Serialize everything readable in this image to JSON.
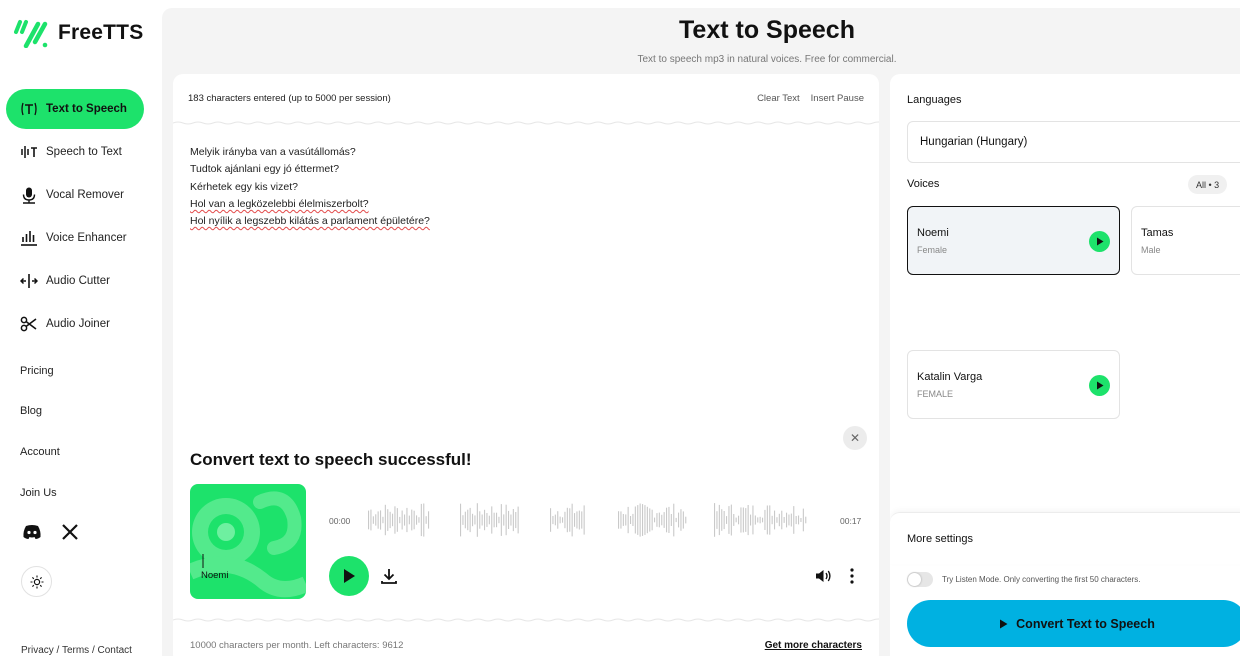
{
  "brand": {
    "name": "FreeTTS",
    "accent": "#1de26b",
    "primary_button": "#00b1e1"
  },
  "sidebar": {
    "items": [
      {
        "label": "Text to Speech",
        "icon": "text-to-speech-icon",
        "active": true
      },
      {
        "label": "Speech to Text",
        "icon": "speech-to-text-icon"
      },
      {
        "label": "Vocal Remover",
        "icon": "microphone-icon"
      },
      {
        "label": "Voice Enhancer",
        "icon": "equalizer-icon"
      },
      {
        "label": "Audio Cutter",
        "icon": "audio-cutter-icon"
      },
      {
        "label": "Audio Joiner",
        "icon": "scissors-icon"
      }
    ],
    "links": [
      "Pricing",
      "Blog",
      "Account",
      "Join Us"
    ],
    "footer": "Privacy / Terms / Contact"
  },
  "header": {
    "title": "Text to Speech",
    "subtitle": "Text to speech mp3 in natural voices. Free for commercial."
  },
  "editor": {
    "char_count": "183 characters entered (up to 5000 per session)",
    "clear_text": "Clear Text",
    "insert_pause": "Insert Pause",
    "lines": [
      "Melyik irányba van a vasútállomás?",
      "Tudtok ajánlani egy jó éttermet?",
      "Kérhetek egy kis vizet?",
      "Hol van a legközelebbi élelmiszerbolt?",
      "Hol nyílik a legszebb kilátás a parlament épületére?"
    ],
    "quota": "10000 characters per month. Left characters: 9612",
    "get_more": "Get more characters"
  },
  "result": {
    "title": "Convert text to speech successful!",
    "cover_label": "Noemi",
    "time_start": "00:00",
    "time_end": "00:17"
  },
  "panel": {
    "languages_label": "Languages",
    "language": "Hungarian (Hungary)",
    "voices_label": "Voices",
    "voice_filter": "All • 3",
    "voices": [
      {
        "name": "Noemi",
        "gender": "Female",
        "selected": true
      },
      {
        "name": "Tamas",
        "gender": "Male"
      },
      {
        "name": "Katalin Varga",
        "gender": "FEMALE"
      }
    ],
    "more_settings": "More settings",
    "listen_mode": "Try Listen Mode. Only converting the first 50 characters.",
    "convert_button": "Convert Text to Speech"
  }
}
